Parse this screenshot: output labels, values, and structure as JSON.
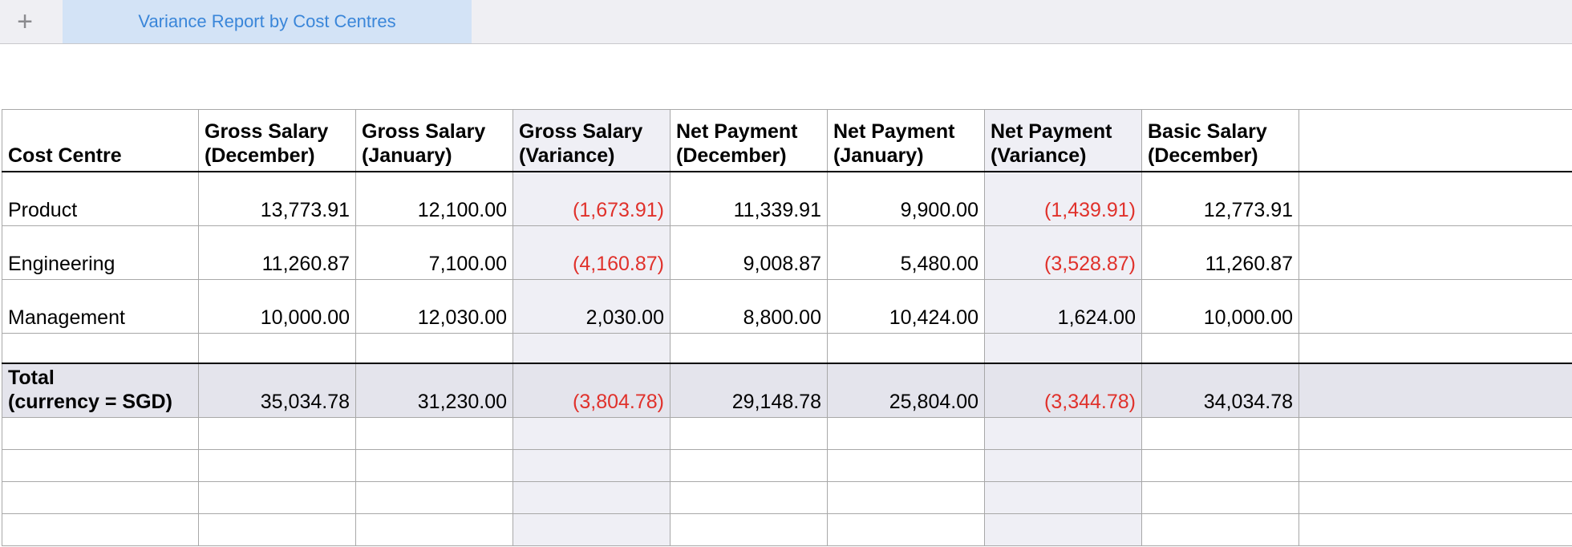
{
  "tabs": {
    "add_label": "+",
    "active_tab": "Variance Report by Cost Centres"
  },
  "table": {
    "columns": [
      "Cost Centre",
      "Gross Salary\n(December)",
      "Gross Salary\n(January)",
      "Gross Salary\n(Variance)",
      "Net Payment\n(December)",
      "Net Payment\n(January)",
      "Net Payment\n(Variance)",
      "Basic Salary\n(December)"
    ],
    "rows": [
      [
        "Product",
        "13,773.91",
        "12,100.00",
        "(1,673.91)",
        "11,339.91",
        "9,900.00",
        "(1,439.91)",
        "12,773.91"
      ],
      [
        "Engineering",
        "11,260.87",
        "7,100.00",
        "(4,160.87)",
        "9,008.87",
        "5,480.00",
        "(3,528.87)",
        "11,260.87"
      ],
      [
        "Management",
        "10,000.00",
        "12,030.00",
        "2,030.00",
        "8,800.00",
        "10,424.00",
        "1,624.00",
        "10,000.00"
      ]
    ],
    "total": [
      "Total\n(currency = SGD)",
      "35,034.78",
      "31,230.00",
      "(3,804.78)",
      "29,148.78",
      "25,804.00",
      "(3,344.78)",
      "34,034.78"
    ]
  },
  "colors": {
    "negative": "#e0312b",
    "tab_active_bg": "#d3e3f6",
    "tab_active_text": "#3a86d9",
    "variance_column_bg": "#efeff5",
    "total_row_bg": "#e4e4ec"
  }
}
